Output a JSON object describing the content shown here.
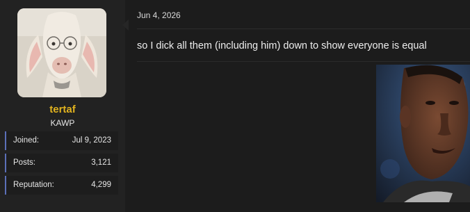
{
  "user": {
    "username": "tertaf",
    "title": "KAWP",
    "avatar_icon": "goat-with-glasses-avatar",
    "username_color": "#e0b21f"
  },
  "stats": [
    {
      "label": "Joined:",
      "value": "Jul 9, 2023"
    },
    {
      "label": "Posts:",
      "value": "3,121"
    },
    {
      "label": "Reputation:",
      "value": "4,299"
    }
  ],
  "post": {
    "date": "Jun 4, 2026",
    "body": "so I dick all them (including him) down to show everyone is equal",
    "image_icon": "man-reaction-photo"
  },
  "colors": {
    "accent": "#5b6fb8",
    "background": "#1c1c1c",
    "sidebar": "#222222"
  }
}
